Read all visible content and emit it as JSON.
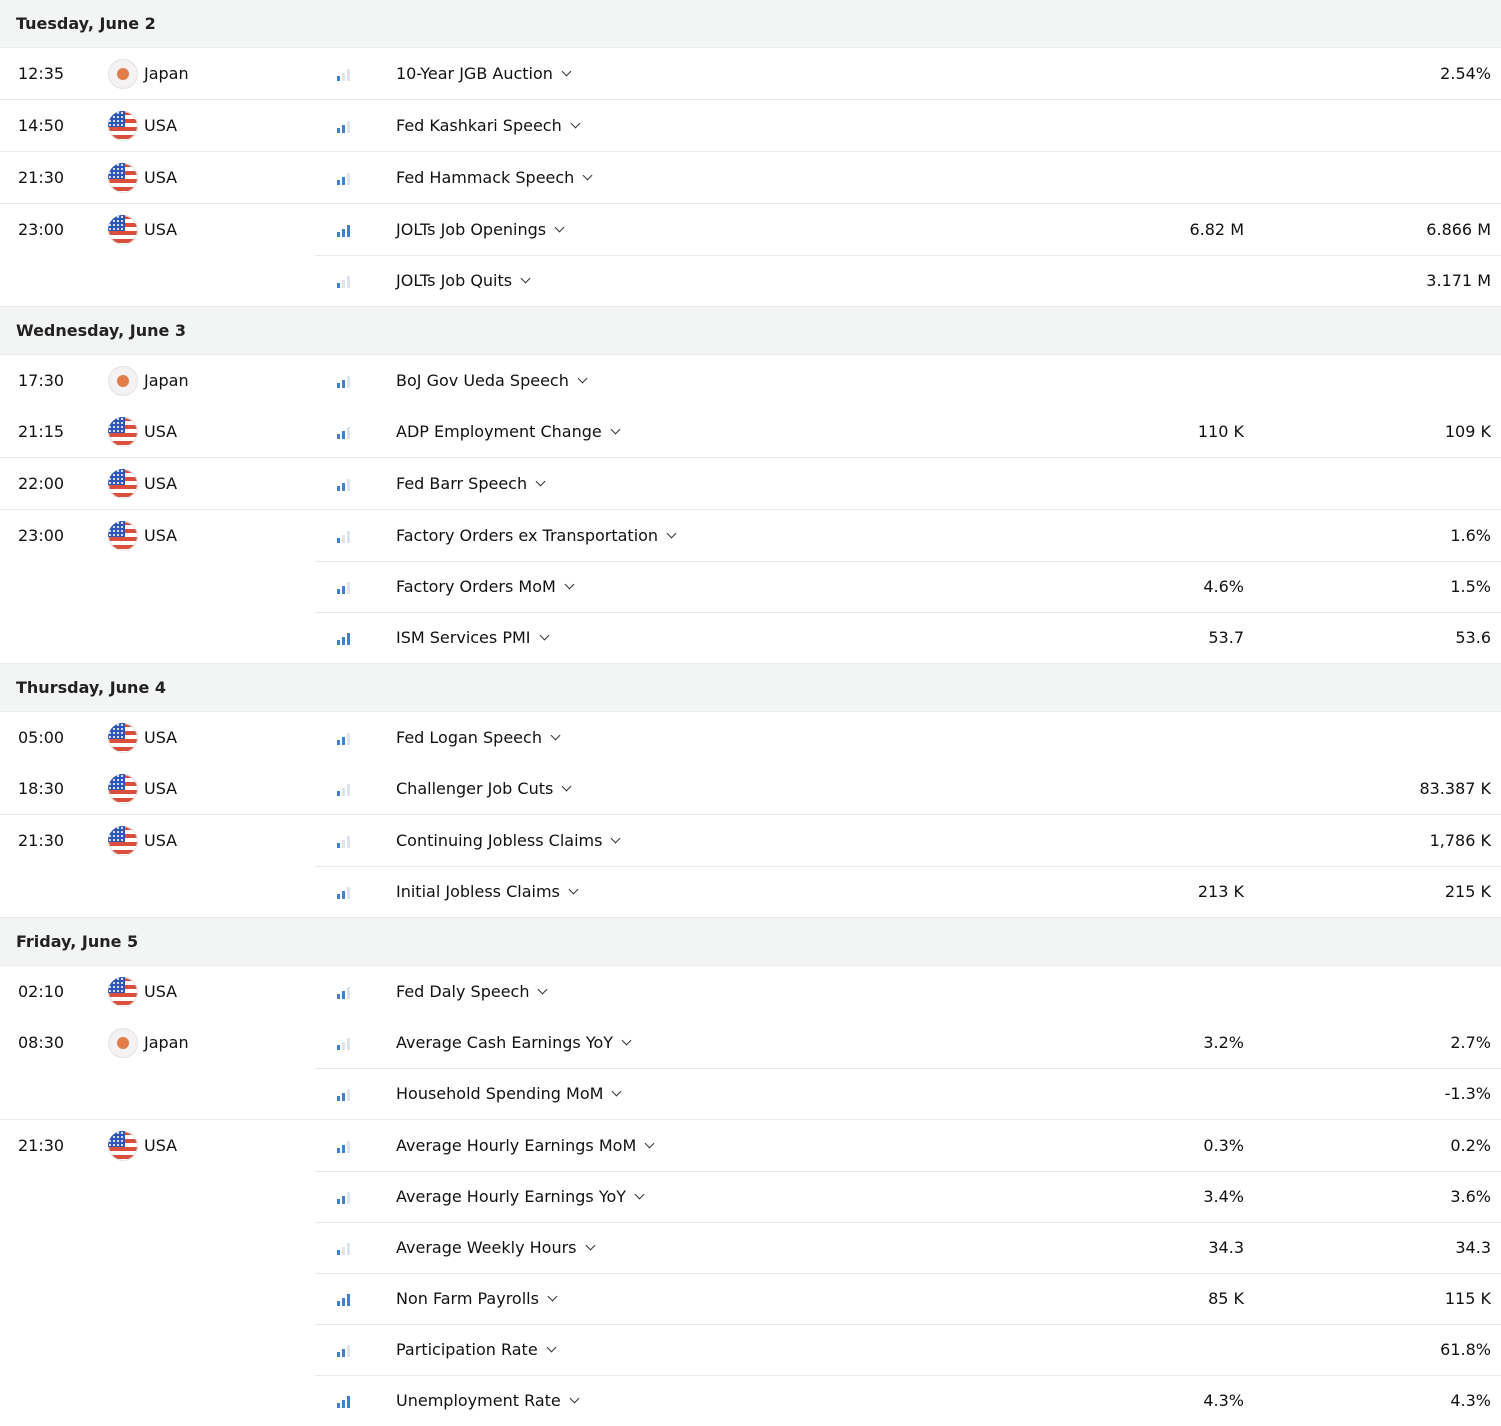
{
  "days": [
    {
      "date": "Tuesday, June 2",
      "groups": [
        {
          "time": "12:35",
          "country": "Japan",
          "flag": "jp",
          "events": [
            {
              "name": "10-Year JGB Auction",
              "importance": 1,
              "forecast": "",
              "prior": "2.54%"
            }
          ]
        },
        {
          "time": "14:50",
          "country": "USA",
          "flag": "us",
          "events": [
            {
              "name": "Fed Kashkari Speech",
              "importance": 2,
              "forecast": "",
              "prior": ""
            }
          ]
        },
        {
          "time": "21:30",
          "country": "USA",
          "flag": "us",
          "events": [
            {
              "name": "Fed Hammack Speech",
              "importance": 2,
              "forecast": "",
              "prior": ""
            }
          ]
        },
        {
          "time": "23:00",
          "country": "USA",
          "flag": "us",
          "events": [
            {
              "name": "JOLTs Job Openings",
              "importance": 3,
              "forecast": "6.82 M",
              "prior": "6.866 M"
            },
            {
              "name": "JOLTs Job Quits",
              "importance": 1,
              "forecast": "",
              "prior": "3.171 M"
            }
          ]
        }
      ]
    },
    {
      "date": "Wednesday, June 3",
      "groups": [
        {
          "time": "17:30",
          "country": "Japan",
          "flag": "jp",
          "noborder": true,
          "events": [
            {
              "name": "BoJ Gov Ueda Speech",
              "importance": 2,
              "forecast": "",
              "prior": ""
            }
          ]
        },
        {
          "time": "21:15",
          "country": "USA",
          "flag": "us",
          "events": [
            {
              "name": "ADP Employment Change",
              "importance": 2,
              "forecast": "110 K",
              "prior": "109 K"
            }
          ]
        },
        {
          "time": "22:00",
          "country": "USA",
          "flag": "us",
          "events": [
            {
              "name": "Fed Barr Speech",
              "importance": 2,
              "forecast": "",
              "prior": ""
            }
          ]
        },
        {
          "time": "23:00",
          "country": "USA",
          "flag": "us",
          "events": [
            {
              "name": "Factory Orders ex Transportation",
              "importance": 1,
              "forecast": "",
              "prior": "1.6%"
            },
            {
              "name": "Factory Orders MoM",
              "importance": 2,
              "forecast": "4.6%",
              "prior": "1.5%"
            },
            {
              "name": "ISM Services PMI",
              "importance": 3,
              "forecast": "53.7",
              "prior": "53.6"
            }
          ]
        }
      ]
    },
    {
      "date": "Thursday, June 4",
      "groups": [
        {
          "time": "05:00",
          "country": "USA",
          "flag": "us",
          "noborder": true,
          "events": [
            {
              "name": "Fed Logan Speech",
              "importance": 2,
              "forecast": "",
              "prior": ""
            }
          ]
        },
        {
          "time": "18:30",
          "country": "USA",
          "flag": "us",
          "events": [
            {
              "name": "Challenger Job Cuts",
              "importance": 1,
              "forecast": "",
              "prior": "83.387 K"
            }
          ]
        },
        {
          "time": "21:30",
          "country": "USA",
          "flag": "us",
          "events": [
            {
              "name": "Continuing Jobless Claims",
              "importance": 1,
              "forecast": "",
              "prior": "1,786 K"
            },
            {
              "name": "Initial Jobless Claims",
              "importance": 2,
              "forecast": "213 K",
              "prior": "215 K"
            }
          ]
        }
      ]
    },
    {
      "date": "Friday, June 5",
      "groups": [
        {
          "time": "02:10",
          "country": "USA",
          "flag": "us",
          "noborder": true,
          "events": [
            {
              "name": "Fed Daly Speech",
              "importance": 2,
              "forecast": "",
              "prior": ""
            }
          ]
        },
        {
          "time": "08:30",
          "country": "Japan",
          "flag": "jp",
          "events": [
            {
              "name": "Average Cash Earnings YoY",
              "importance": 1,
              "forecast": "3.2%",
              "prior": "2.7%"
            },
            {
              "name": "Household Spending MoM",
              "importance": 2,
              "forecast": "",
              "prior": "-1.3%"
            }
          ]
        },
        {
          "time": "21:30",
          "country": "USA",
          "flag": "us",
          "noborder": true,
          "events": [
            {
              "name": "Average Hourly Earnings MoM",
              "importance": 2,
              "forecast": "0.3%",
              "prior": "0.2%"
            },
            {
              "name": "Average Hourly Earnings YoY",
              "importance": 2,
              "forecast": "3.4%",
              "prior": "3.6%"
            },
            {
              "name": "Average Weekly Hours",
              "importance": 1,
              "forecast": "34.3",
              "prior": "34.3"
            },
            {
              "name": "Non Farm Payrolls",
              "importance": 3,
              "forecast": "85 K",
              "prior": "115 K"
            },
            {
              "name": "Participation Rate",
              "importance": 2,
              "forecast": "",
              "prior": "61.8%"
            },
            {
              "name": "Unemployment Rate",
              "importance": 3,
              "forecast": "4.3%",
              "prior": "4.3%"
            }
          ]
        }
      ]
    }
  ]
}
